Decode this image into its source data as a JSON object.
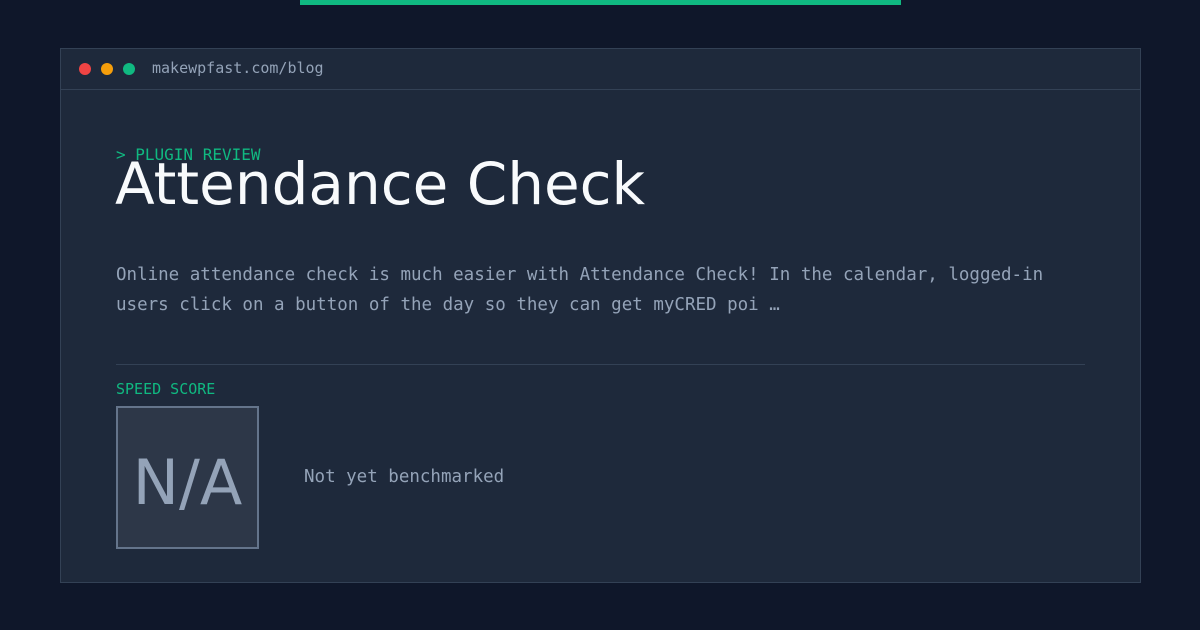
{
  "window": {
    "url": "makewpfast.com/blog"
  },
  "article": {
    "kicker": "> PLUGIN REVIEW",
    "title": "Attendance Check",
    "description": "Online attendance check is much easier with Attendance Check! In the calendar, logged-in users click on a button of the day so they can get myCRED poi …"
  },
  "speed": {
    "label": "SPEED SCORE",
    "value": "N/A",
    "note": "Not yet benchmarked"
  },
  "colors": {
    "background": "#0f172a",
    "panel": "#1e293b",
    "accent": "#10b981",
    "window_close": "#ef4444",
    "window_minimize": "#f59e0b",
    "window_maximize": "#10b981"
  }
}
